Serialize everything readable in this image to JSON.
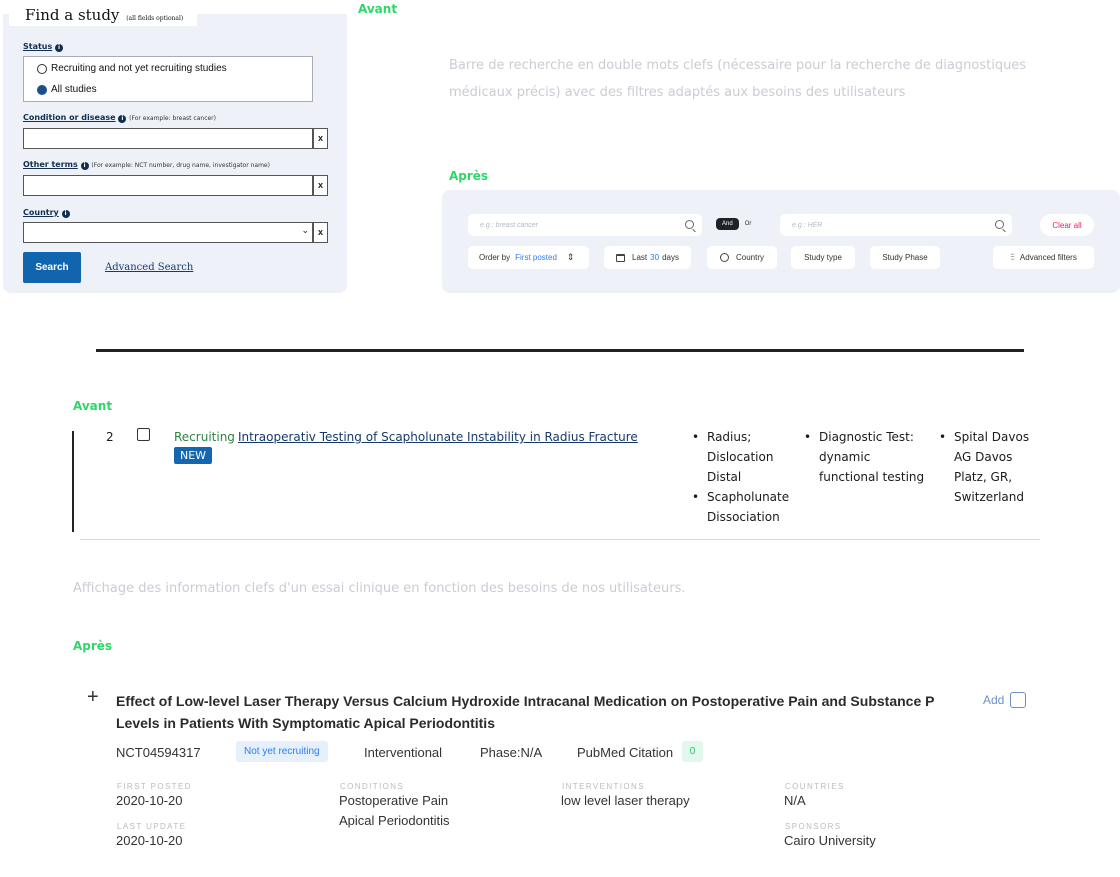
{
  "labels": {
    "avant": "Avant",
    "apres": "Après"
  },
  "old_form": {
    "title": "Find a study",
    "title_note": "(all fields optional)",
    "status_label": "Status",
    "status_options": [
      "Recruiting and not yet recruiting studies",
      "All studies"
    ],
    "status_selected": "All studies",
    "condition_label": "Condition or disease",
    "condition_hint": "(For example: breast cancer)",
    "other_terms_label": "Other terms",
    "other_terms_hint": "(For example: NCT number, drug name, investigator name)",
    "country_label": "Country",
    "clear_symbol": "x",
    "search_button": "Search",
    "advanced_link": "Advanced Search"
  },
  "search_description": "Barre de recherche en double mots clefs (nécessaire pour la recherche de diagnostiques médicaux précis) avec des filtres adaptés aux besoins des utilisateurs",
  "new_search": {
    "input1_placeholder": "e.g.: breast cancer",
    "and_label": "And",
    "or_label": "Or",
    "input2_placeholder": "e.g.: HER",
    "clear_all": "Clear all",
    "order_by_label": "Order by",
    "order_by_value": "First posted",
    "last_prefix": "Last",
    "last_value": "30",
    "last_suffix": "days",
    "country": "Country",
    "study_type": "Study type",
    "study_phase": "Study Phase",
    "advanced_filters": "Advanced filters",
    "accent_color": "#2e7df0",
    "clear_color": "#e0245e"
  },
  "old_result": {
    "index": "2",
    "status": "Recruiting",
    "title": "Intraoperativ Testing of Scapholunate Instability in Radius Fracture",
    "badge": "NEW",
    "conditions": [
      "Radius; Dislocation Distal",
      "Scapholunate Dissociation"
    ],
    "interventions": [
      "Diagnostic Test: dynamic functional testing"
    ],
    "locations": [
      "Spital Davos AG Davos Platz, GR, Switzerland"
    ]
  },
  "result_description": "Affichage des information clefs d'un essai clinique en fonction des besoins de nos utilisateurs.",
  "new_result": {
    "expand_symbol": "+",
    "title_line1": "Effect of Low-level Laser Therapy Versus Calcium Hydroxide Intracanal Medication on Postoperative Pain and Substance P",
    "title_line2": "Levels in Patients With Symptomatic Apical Periodontitis",
    "add_label": "Add",
    "nct_id": "NCT04594317",
    "status_badge": "Not yet recruiting",
    "study_type": "Interventional",
    "phase": "Phase:N/A",
    "pubmed_label": "PubMed Citation",
    "pubmed_count": "0",
    "first_posted_label": "FIRST POSTED",
    "first_posted": "2020-10-20",
    "last_update_label": "LAST UPDATE",
    "last_update": "2020-10-20",
    "conditions_label": "CONDITIONS",
    "conditions": [
      "Postoperative Pain",
      "Apical Periodontitis"
    ],
    "interventions_label": "INTERVENTIONS",
    "interventions": [
      "low level laser therapy"
    ],
    "countries_label": "COUNTRIES",
    "countries": "N/A",
    "sponsors_label": "SPONSORS",
    "sponsors": "Cairo University"
  }
}
